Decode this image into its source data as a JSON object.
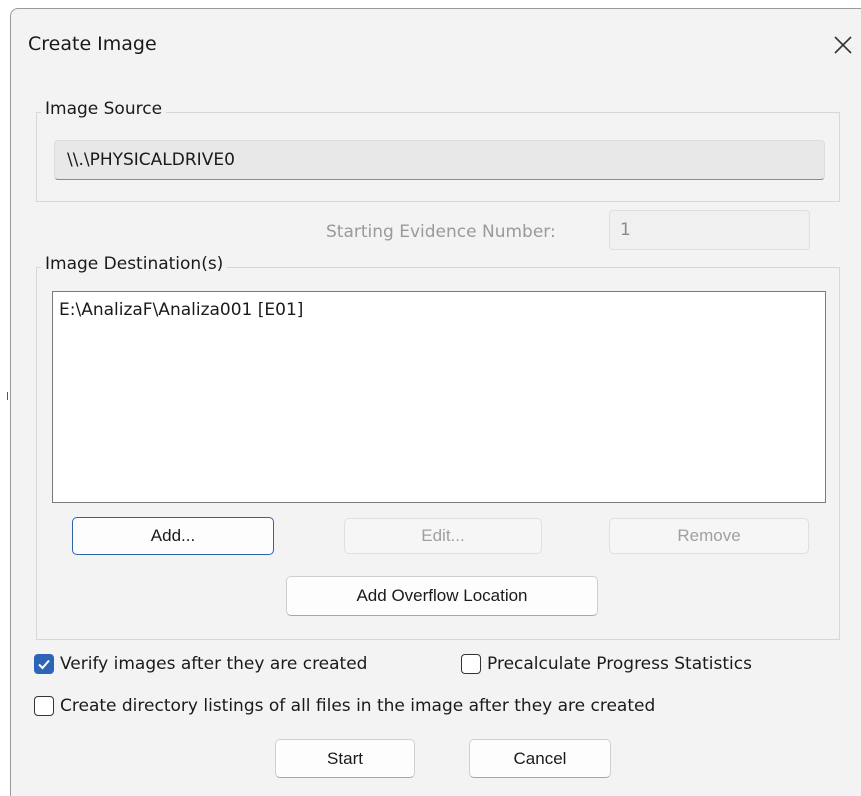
{
  "window": {
    "title": "Create Image"
  },
  "image_source": {
    "legend": "Image Source",
    "value": "\\\\.\\PHYSICALDRIVE0"
  },
  "evidence": {
    "label": "Starting Evidence Number:",
    "value": "1"
  },
  "image_destinations": {
    "legend": "Image Destination(s)",
    "items": [
      "E:\\AnalizaF\\Analiza001 [E01]"
    ],
    "add_label": "Add...",
    "edit_label": "Edit...",
    "remove_label": "Remove",
    "overflow_label": "Add Overflow Location"
  },
  "options": {
    "verify": {
      "label": "Verify images after they are created",
      "checked": true
    },
    "precalculate": {
      "label": "Precalculate Progress Statistics",
      "checked": false
    },
    "directory_listings": {
      "label": "Create directory listings of all files in the image after they are created",
      "checked": false
    }
  },
  "footer": {
    "start_label": "Start",
    "cancel_label": "Cancel"
  },
  "colors": {
    "accent": "#2e64b5",
    "focus_border": "#2c63a8",
    "dialog_bg": "#f3f3f3"
  }
}
